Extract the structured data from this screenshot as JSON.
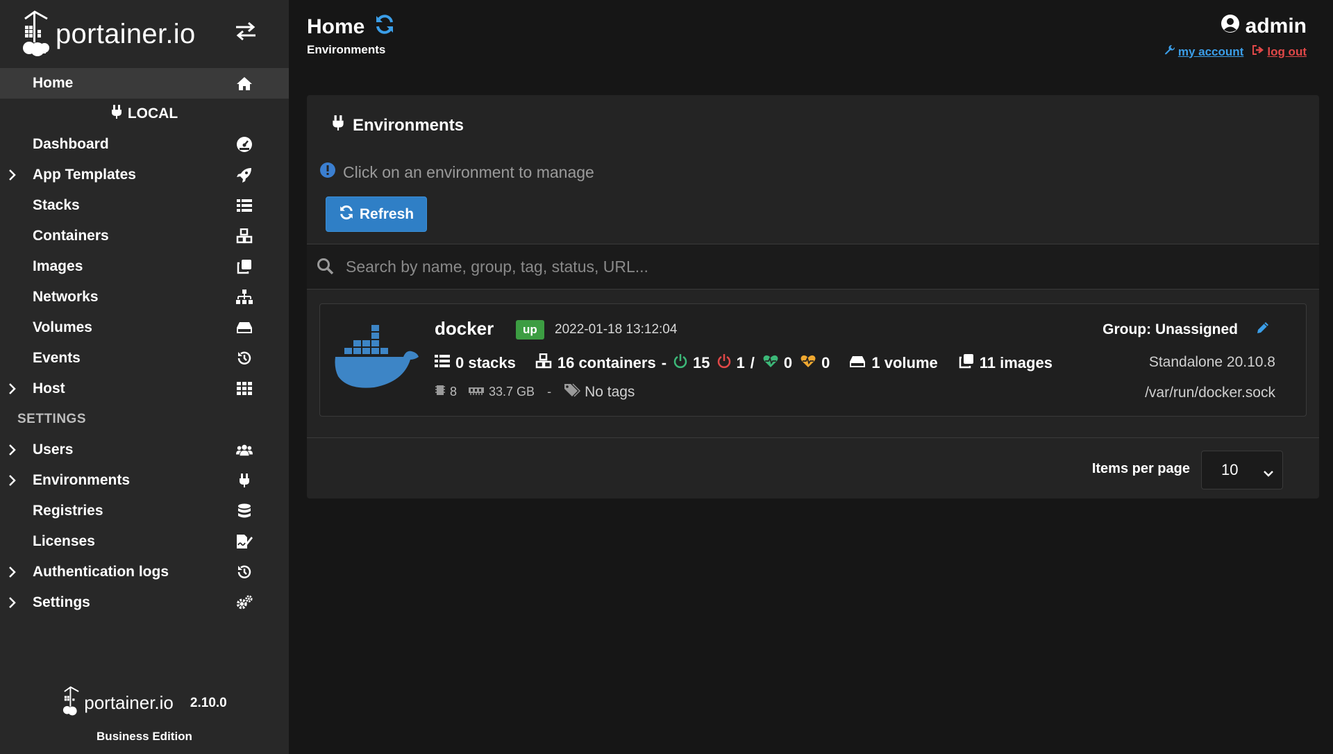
{
  "brand": {
    "name": "portainer.io"
  },
  "sidebar": {
    "home_label": "Home",
    "environment_heading": "LOCAL",
    "items": [
      {
        "label": "Dashboard"
      },
      {
        "label": "App Templates"
      },
      {
        "label": "Stacks"
      },
      {
        "label": "Containers"
      },
      {
        "label": "Images"
      },
      {
        "label": "Networks"
      },
      {
        "label": "Volumes"
      },
      {
        "label": "Events"
      },
      {
        "label": "Host"
      }
    ],
    "settings_heading": "SETTINGS",
    "settings_items": [
      {
        "label": "Users"
      },
      {
        "label": "Environments"
      },
      {
        "label": "Registries"
      },
      {
        "label": "Licenses"
      },
      {
        "label": "Authentication logs"
      },
      {
        "label": "Settings"
      }
    ],
    "footer": {
      "brand": "portainer.io",
      "version": "2.10.0",
      "edition": "Business Edition"
    }
  },
  "header": {
    "title": "Home",
    "breadcrumb": "Environments",
    "user": "admin",
    "my_account": "my account",
    "log_out": "log out"
  },
  "panel": {
    "title": "Environments",
    "hint": "Click on an environment to manage",
    "refresh_label": "Refresh",
    "search_placeholder": "Search by name, group, tag, status, URL...",
    "items_per_page_label": "Items per page",
    "items_per_page_value": "10"
  },
  "environment": {
    "name": "docker",
    "status": "up",
    "timestamp": "2022-01-18 13:12:04",
    "stacks": "0 stacks",
    "containers": "16 containers",
    "dash": "-",
    "running": "15",
    "stopped": "1",
    "slash": "/",
    "healthy": "0",
    "unhealthy": "0",
    "volumes": "1 volume",
    "images": "11 images",
    "cpus": "8",
    "memory": "33.7 GB",
    "meta_dash": "-",
    "tags": "No tags",
    "group": "Group: Unassigned",
    "version": "Standalone 20.10.8",
    "url": "/var/run/docker.sock"
  },
  "colors": {
    "accent": "#2f7fc6",
    "success": "#3c9d42",
    "danger": "#e04848",
    "warning": "#f0a830",
    "sidebar_bg": "#282828",
    "page_bg": "#161616"
  }
}
